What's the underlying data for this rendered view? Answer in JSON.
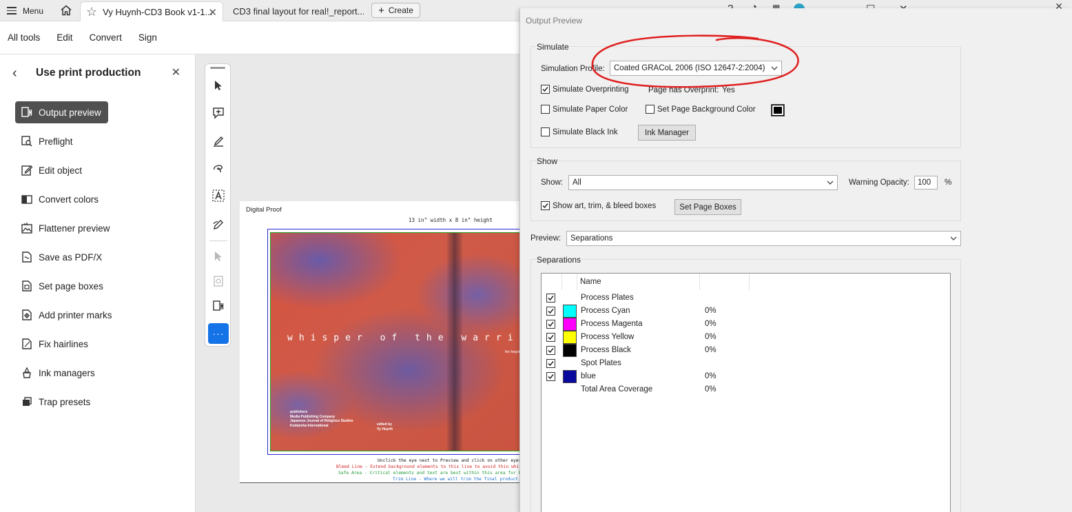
{
  "tabbar": {
    "menu_label": "Menu",
    "active_tab": "Vy Huynh-CD3 Book v1-1...",
    "inactive_tab": "CD3 final layout for real!_report...",
    "create_label": "Create"
  },
  "menubar": {
    "items": [
      "All tools",
      "Edit",
      "Convert",
      "Sign"
    ]
  },
  "left_panel": {
    "title": "Use print production",
    "items": [
      {
        "label": "Output preview",
        "icon": "output-preview-icon",
        "active": true
      },
      {
        "label": "Preflight",
        "icon": "preflight-icon"
      },
      {
        "label": "Edit object",
        "icon": "edit-object-icon"
      },
      {
        "label": "Convert colors",
        "icon": "convert-colors-icon"
      },
      {
        "label": "Flattener preview",
        "icon": "flattener-preview-icon"
      },
      {
        "label": "Save as PDF/X",
        "icon": "save-pdfx-icon"
      },
      {
        "label": "Set page boxes",
        "icon": "set-page-boxes-icon"
      },
      {
        "label": "Add printer marks",
        "icon": "add-printer-marks-icon"
      },
      {
        "label": "Fix hairlines",
        "icon": "fix-hairlines-icon"
      },
      {
        "label": "Ink managers",
        "icon": "ink-managers-icon"
      },
      {
        "label": "Trap presets",
        "icon": "trap-presets-icon"
      }
    ]
  },
  "document": {
    "proof_label": "Digital Proof",
    "dimensions": "13 in\" width x 8 in\" height",
    "art_title": "whisper of the warrio",
    "art_subtitle": "the forgott",
    "art_publishers": [
      "publishers",
      "Media Publishing Company",
      "Japanese Journal of Religious Studies",
      "Kodansha International"
    ],
    "art_editor": [
      "edited by",
      "Vy Huynh"
    ],
    "notes": [
      {
        "text": "Unclick the eye next to Preview and click on other eyes to see",
        "color": "#111111"
      },
      {
        "text": "Bleed Line - Extend background elements to this line to avoid thin white lines in",
        "color": "#d42020"
      },
      {
        "text": "Safe Area - Critical elements and text are best within this area for best spaci",
        "color": "#1e9a3a"
      },
      {
        "text": "Trim Line - Where we will trim the final product.",
        "color": "#1a6fd0"
      }
    ]
  },
  "dialog": {
    "title": "Output Preview",
    "simulate": {
      "group_label": "Simulate",
      "profile_label": "Simulation Profile:",
      "profile_value": "Coated GRACoL 2006 (ISO 12647-2:2004)",
      "overprinting_label": "Simulate Overprinting",
      "overprinting_checked": true,
      "page_overprint_label": "Page has Overprint:",
      "page_overprint_value": "Yes",
      "paper_color_label": "Simulate Paper Color",
      "page_bg_label": "Set Page Background Color",
      "black_ink_label": "Simulate Black Ink",
      "ink_manager_button": "Ink Manager"
    },
    "show": {
      "group_label": "Show",
      "show_label": "Show:",
      "show_value": "All",
      "warning_label": "Warning Opacity:",
      "warning_value": "100",
      "percent": "%",
      "boxes_label": "Show art, trim, & bleed boxes",
      "boxes_checked": true,
      "set_boxes_button": "Set Page Boxes"
    },
    "preview": {
      "label": "Preview:",
      "value": "Separations"
    },
    "separations": {
      "group_label": "Separations",
      "name_header": "Name",
      "rows": [
        {
          "name": "Process Plates",
          "checked": true,
          "swatch": null,
          "value": ""
        },
        {
          "name": "Process Cyan",
          "checked": true,
          "swatch": "#00ffff",
          "value": "0%"
        },
        {
          "name": "Process Magenta",
          "checked": true,
          "swatch": "#ff00ff",
          "value": "0%"
        },
        {
          "name": "Process Yellow",
          "checked": true,
          "swatch": "#ffff00",
          "value": "0%"
        },
        {
          "name": "Process Black",
          "checked": true,
          "swatch": "#000000",
          "value": "0%"
        },
        {
          "name": "Spot Plates",
          "checked": true,
          "swatch": null,
          "value": ""
        },
        {
          "name": "blue",
          "checked": true,
          "swatch": "#0a0a9e",
          "value": "0%"
        },
        {
          "name": "Total Area Coverage",
          "checked": null,
          "swatch": null,
          "value": "0%"
        }
      ]
    }
  },
  "colors": {
    "accent": "#1473e6",
    "annotation_red": "#e02020",
    "active_item_bg": "#505050"
  }
}
